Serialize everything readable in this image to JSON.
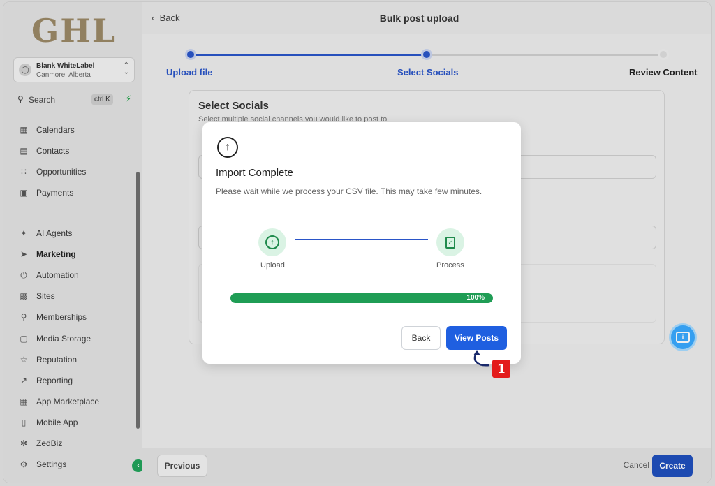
{
  "sidebar": {
    "logo": "GHL",
    "account": {
      "name": "Blank WhiteLabel",
      "location": "Canmore, Alberta"
    },
    "search": {
      "label": "Search",
      "shortcut": "ctrl K"
    },
    "items_top": [
      {
        "label": "Calendars",
        "icon": "calendar-icon"
      },
      {
        "label": "Contacts",
        "icon": "contacts-icon"
      },
      {
        "label": "Opportunities",
        "icon": "opportunities-icon"
      },
      {
        "label": "Payments",
        "icon": "payments-icon"
      }
    ],
    "items_bottom": [
      {
        "label": "AI Agents",
        "icon": "sparkle-icon"
      },
      {
        "label": "Marketing",
        "icon": "send-icon"
      },
      {
        "label": "Automation",
        "icon": "automation-icon"
      },
      {
        "label": "Sites",
        "icon": "sites-icon"
      },
      {
        "label": "Memberships",
        "icon": "membership-icon"
      },
      {
        "label": "Media Storage",
        "icon": "media-icon"
      },
      {
        "label": "Reputation",
        "icon": "star-icon"
      },
      {
        "label": "Reporting",
        "icon": "chart-icon"
      },
      {
        "label": "App Marketplace",
        "icon": "grid-icon"
      },
      {
        "label": "Mobile App",
        "icon": "mobile-icon"
      },
      {
        "label": "ZedBiz",
        "icon": "zedbiz-icon"
      },
      {
        "label": "Settings",
        "icon": "gear-icon"
      }
    ],
    "active": "Marketing"
  },
  "header": {
    "back": "Back",
    "title": "Bulk post upload"
  },
  "stepper": {
    "steps": [
      {
        "label": "Upload file",
        "state": "done"
      },
      {
        "label": "Select Socials",
        "state": "current"
      },
      {
        "label": "Review Content",
        "state": "todo"
      }
    ],
    "colors": {
      "active": "#2a55c8",
      "inactive": "#cfcfcf"
    }
  },
  "panel": {
    "title": "Select Socials",
    "subtitle": "Select multiple social channels you would like to post to"
  },
  "modal": {
    "title": "Import Complete",
    "description": "Please wait while we process your CSV file. This may take few minutes.",
    "steps": [
      {
        "label": "Upload",
        "icon": "upload-circle-icon"
      },
      {
        "label": "Process",
        "icon": "document-check-icon"
      }
    ],
    "progress_value": 1.0,
    "progress_label": "100%",
    "back_label": "Back",
    "view_posts_label": "View Posts",
    "colors": {
      "primary": "#1f5fe0",
      "progress": "#1f9d55",
      "node_bg": "#daf3e4"
    }
  },
  "annotation": {
    "number": "1"
  },
  "footer": {
    "previous": "Previous",
    "cancel": "Cancel",
    "create": "Create"
  }
}
